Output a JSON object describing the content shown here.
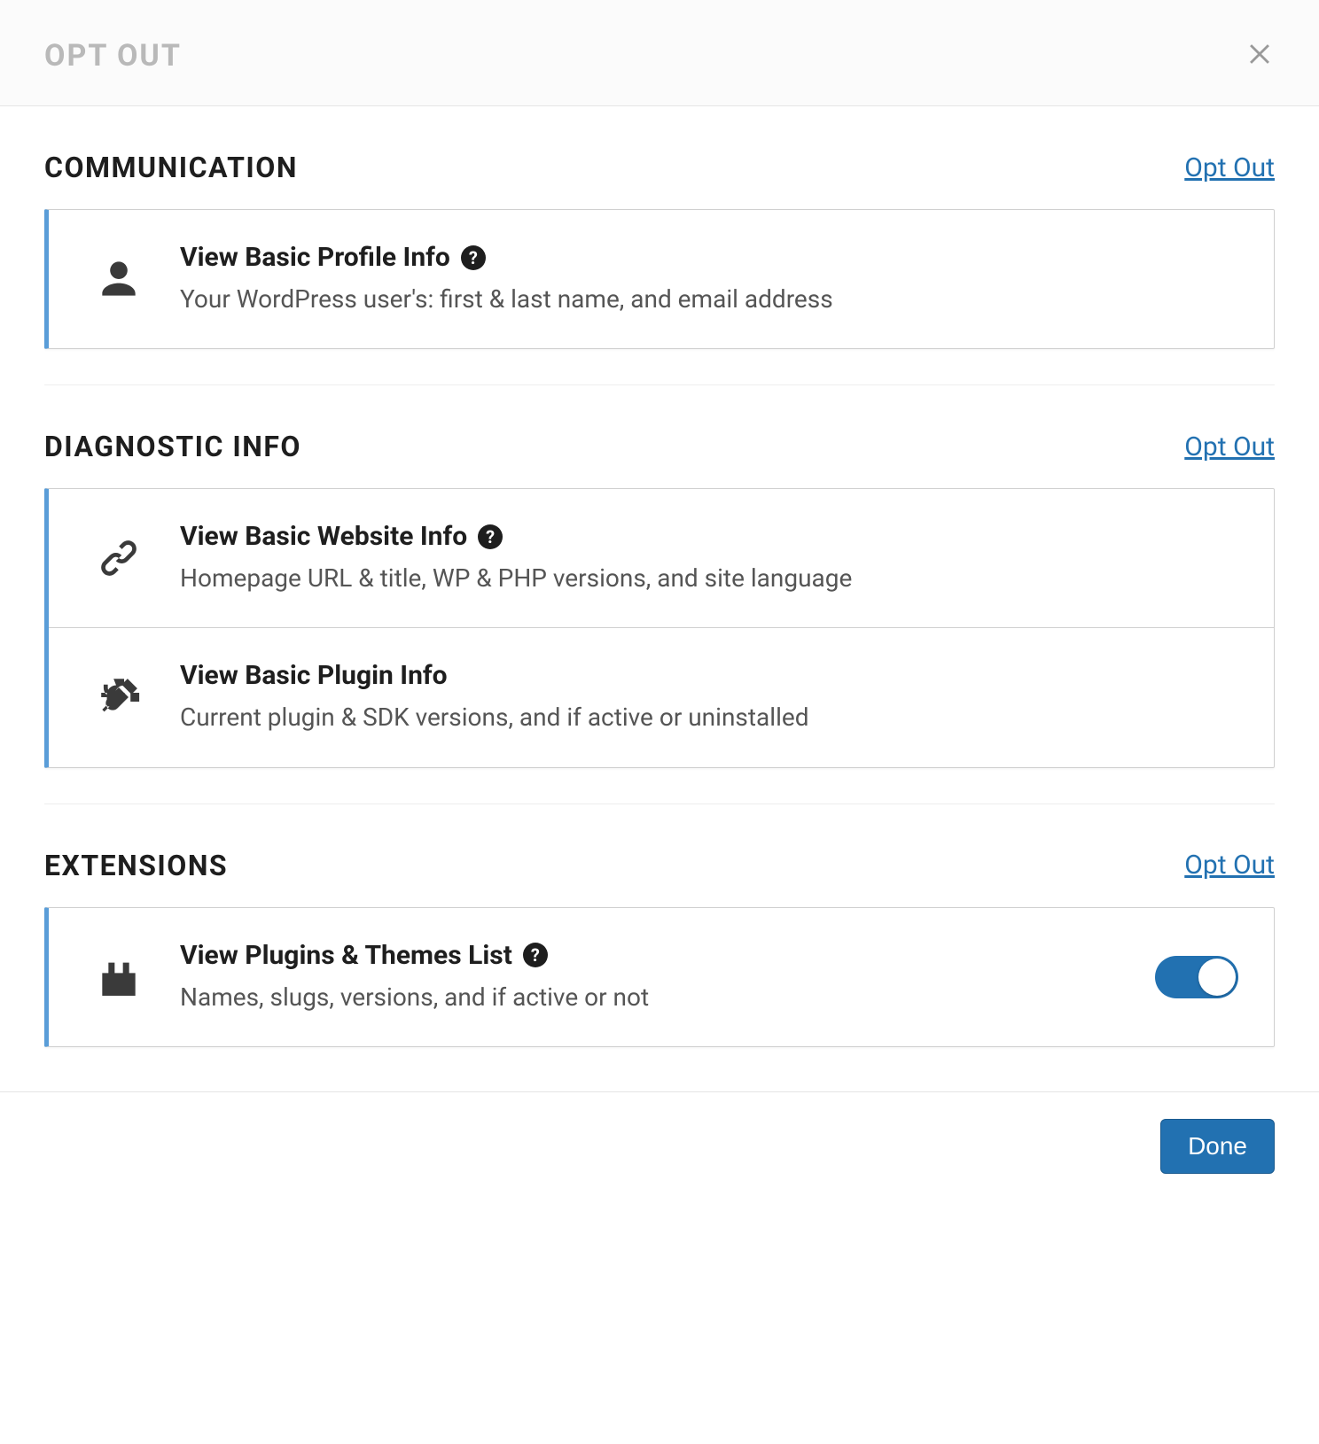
{
  "modal": {
    "title": "OPT OUT",
    "doneLabel": "Done"
  },
  "sections": {
    "communication": {
      "title": "COMMUNICATION",
      "optOutLabel": "Opt Out",
      "items": [
        {
          "title": "View Basic Profile Info",
          "desc": "Your WordPress user's: first & last name, and email address",
          "icon": "user-icon",
          "hasHelp": true
        }
      ]
    },
    "diagnostic": {
      "title": "DIAGNOSTIC INFO",
      "optOutLabel": "Opt Out",
      "items": [
        {
          "title": "View Basic Website Info",
          "desc": "Homepage URL & title, WP & PHP versions, and site language",
          "icon": "link-icon",
          "hasHelp": true
        },
        {
          "title": "View Basic Plugin Info",
          "desc": "Current plugin & SDK versions, and if active or uninstalled",
          "icon": "plug-icon",
          "hasHelp": false
        }
      ]
    },
    "extensions": {
      "title": "EXTENSIONS",
      "optOutLabel": "Opt Out",
      "items": [
        {
          "title": "View Plugins & Themes List",
          "desc": "Names, slugs, versions, and if active or not",
          "icon": "plugins-icon",
          "hasHelp": true,
          "toggle": true
        }
      ]
    }
  },
  "colors": {
    "accent": "#2271b1",
    "cardBorderAccent": "#5a9dd8"
  }
}
